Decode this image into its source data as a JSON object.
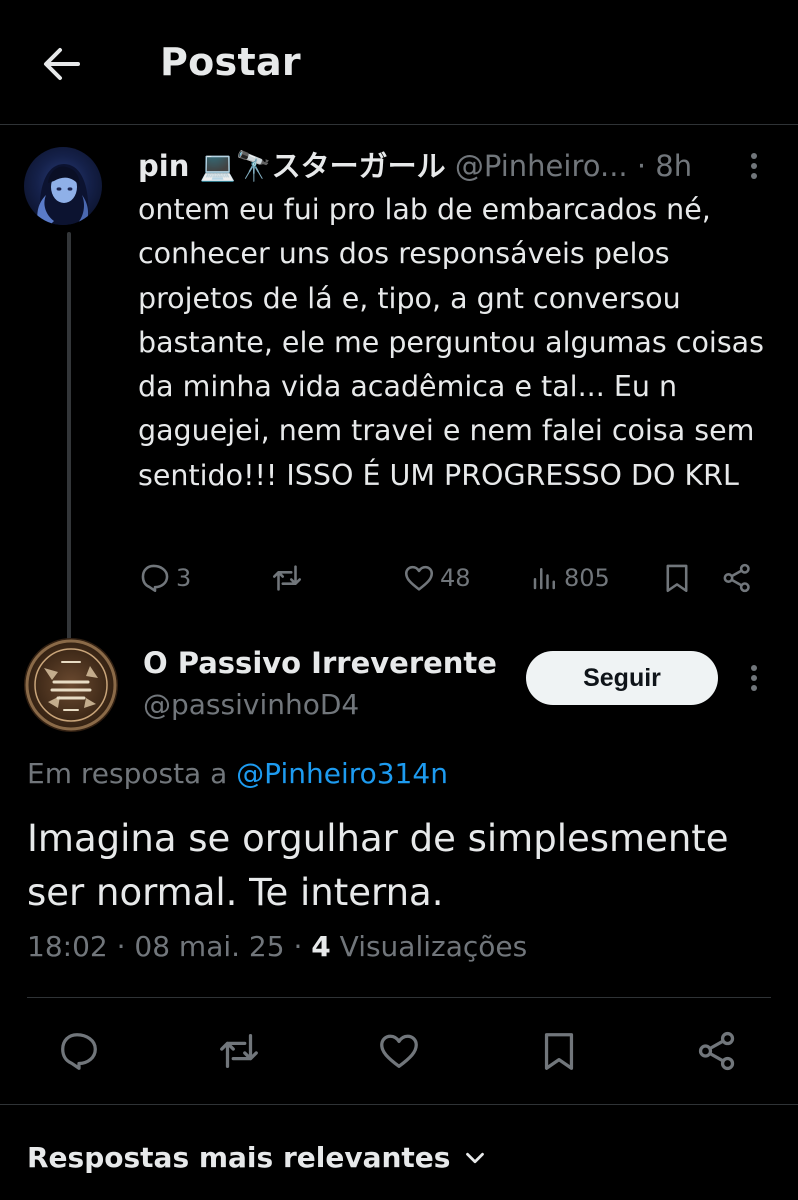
{
  "header": {
    "title": "Postar"
  },
  "parent_tweet": {
    "name": "pin 💻🔭スターガール",
    "handle": "@Pinheiro...",
    "sep": " · ",
    "time": "8h",
    "text": "ontem eu fui pro lab de embarcados né, conhecer uns dos responsáveis pelos projetos de lá e, tipo, a gnt conversou bastante, ele me perguntou algumas coisas da minha vida acadêmica e tal... Eu n gaguejei, nem travei e nem falei coisa sem sentido!!! ISSO É UM PROGRESSO DO KRL",
    "replies": "3",
    "likes": "48",
    "views": "805"
  },
  "reply_tweet": {
    "name": "O Passivo Irreverente",
    "handle": "@passivinhoD4",
    "follow_label": "Seguir",
    "reply_prefix": "Em resposta a ",
    "reply_mention": "@Pinheiro314n",
    "text": "Imagina se orgulhar de simplesmente ser normal. Te interna.",
    "timestamp": "18:02 · 08 mai. 25 · ",
    "views_count": "4",
    "views_label": " Visualizações"
  },
  "sort": {
    "label": "Respostas mais relevantes"
  },
  "icons": {
    "back": "arrow-left-icon",
    "more": "more-vertical-icon",
    "reply": "reply-icon",
    "repost": "repost-icon",
    "like": "heart-icon",
    "views": "views-icon",
    "bookmark": "bookmark-icon",
    "share": "share-icon",
    "chevron": "chevron-down-icon"
  },
  "colors": {
    "background": "#000000",
    "text": "#e7e9ea",
    "muted": "#71767b",
    "link": "#1d9bf0",
    "divider": "#2f3336"
  }
}
